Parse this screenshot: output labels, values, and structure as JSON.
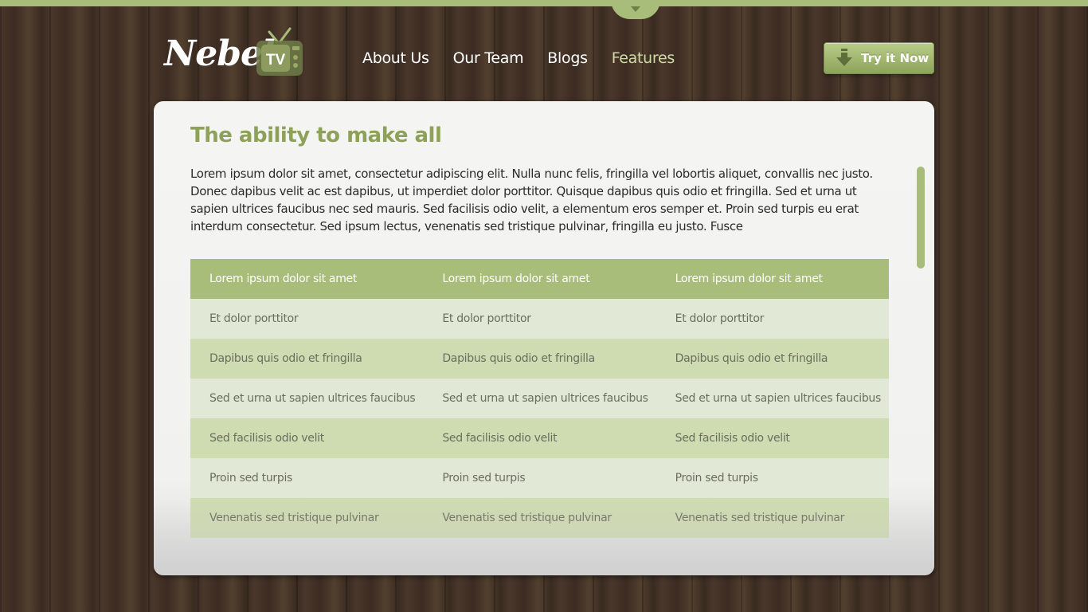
{
  "brand": {
    "name": "Nebel.",
    "tv_text": "TV",
    "accent_color": "#a8bd79",
    "title_color": "#8ea158"
  },
  "header": {
    "top_tab_icon": "chevron-down-icon",
    "nav": [
      {
        "label": "About Us",
        "active": false
      },
      {
        "label": "Our Team",
        "active": false
      },
      {
        "label": "Blogs",
        "active": false
      },
      {
        "label": "Features",
        "active": true
      }
    ],
    "cta": {
      "label": "Try it Now",
      "icon": "download-arrow-icon"
    }
  },
  "main": {
    "title": "The ability to make all",
    "body": "Lorem ipsum dolor sit amet, consectetur adipiscing elit. Nulla nunc felis, fringilla vel lobortis aliquet, convallis nec justo. Donec dapibus velit ac est dapibus, ut imperdiet dolor porttitor. Quisque dapibus quis odio et fringilla. Sed et urna ut sapien ultrices faucibus nec sed mauris. Sed facilisis odio velit, a elementum eros semper et. Proin sed turpis eu erat interdum consectetur. Sed ipsum lectus, venenatis sed tristique pulvinar, fringilla eu justo. Fusce",
    "table": {
      "headers": [
        "Lorem ipsum dolor sit amet",
        "Lorem ipsum dolor sit amet",
        "Lorem ipsum dolor sit amet"
      ],
      "rows": [
        [
          "Et dolor porttitor",
          "Et dolor porttitor",
          "Et dolor porttitor"
        ],
        [
          "Dapibus quis odio et fringilla",
          "Dapibus quis odio et fringilla",
          "Dapibus quis odio et fringilla"
        ],
        [
          "Sed et urna ut sapien ultrices faucibus",
          "Sed et urna ut sapien ultrices faucibus",
          "Sed et urna ut sapien ultrices faucibus"
        ],
        [
          "Sed facilisis odio velit",
          "Sed facilisis odio velit",
          "Sed facilisis odio velit"
        ],
        [
          "Proin sed turpis",
          "Proin sed turpis",
          "Proin sed turpis"
        ],
        [
          "Venenatis sed tristique pulvinar",
          "Venenatis sed tristique pulvinar",
          "Venenatis sed tristique pulvinar"
        ]
      ]
    }
  }
}
